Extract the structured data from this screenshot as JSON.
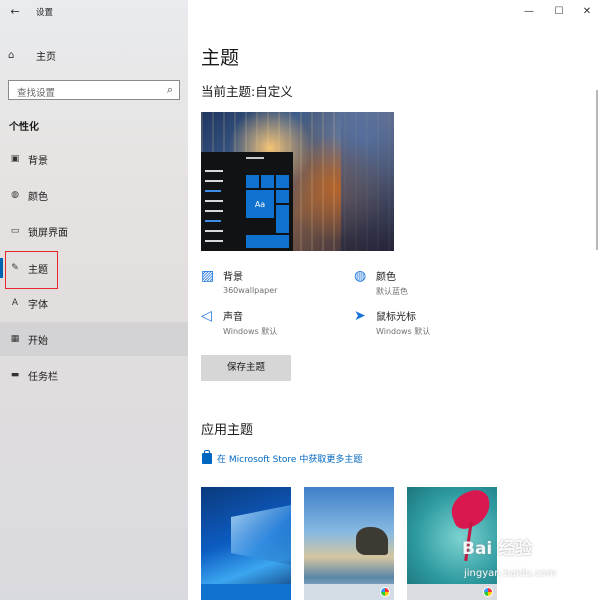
{
  "window": {
    "app_title": "设置",
    "back_glyph": "←",
    "minimize_glyph": "—",
    "maximize_glyph": "☐",
    "close_glyph": "✕"
  },
  "sidebar": {
    "home_label": "主页",
    "home_glyph": "⌂",
    "search_placeholder": "查找设置",
    "search_glyph": "⌕",
    "section": "个性化",
    "items": [
      {
        "label": "背景",
        "icon": "picture-icon",
        "glyph": "▣"
      },
      {
        "label": "颜色",
        "icon": "palette-icon",
        "glyph": "◍"
      },
      {
        "label": "锁屏界面",
        "icon": "lock-screen-icon",
        "glyph": "▭"
      },
      {
        "label": "主题",
        "icon": "theme-brush-icon",
        "glyph": "✎",
        "selected": true
      },
      {
        "label": "字体",
        "icon": "font-icon",
        "glyph": "A"
      },
      {
        "label": "开始",
        "icon": "start-icon",
        "glyph": "▦"
      },
      {
        "label": "任务栏",
        "icon": "taskbar-icon",
        "glyph": "▬"
      }
    ],
    "accent_color": "#0063b1",
    "annotation_color": "#e8262b"
  },
  "main": {
    "title": "主题",
    "current_theme": "当前主题:自定义",
    "preview_tile_text": "Aa",
    "settings": [
      {
        "title": "背景",
        "value": "360wallpaper",
        "icon": "picture-icon",
        "glyph": "▨"
      },
      {
        "title": "颜色",
        "value": "默认蓝色",
        "icon": "palette-icon",
        "glyph": "◍"
      },
      {
        "title": "声音",
        "value": "Windows 默认",
        "icon": "speaker-icon",
        "glyph": "◁"
      },
      {
        "title": "鼠标光标",
        "value": "Windows 默认",
        "icon": "cursor-icon",
        "glyph": "➤"
      }
    ],
    "save_button": "保存主题",
    "apply_heading": "应用主题",
    "store_link": "在 Microsoft Store 中获取更多主题",
    "link_color": "#0067c0",
    "themes": [
      {
        "name": "windows-theme",
        "bar_color": "#0f72cf"
      },
      {
        "name": "windows-10-theme",
        "bar_color": "#d4dde6"
      },
      {
        "name": "flowers-theme",
        "bar_color": "#d9dde2"
      }
    ]
  },
  "watermark": {
    "line1": "Bai 经验",
    "line2": "jingyan.baidu.com"
  }
}
